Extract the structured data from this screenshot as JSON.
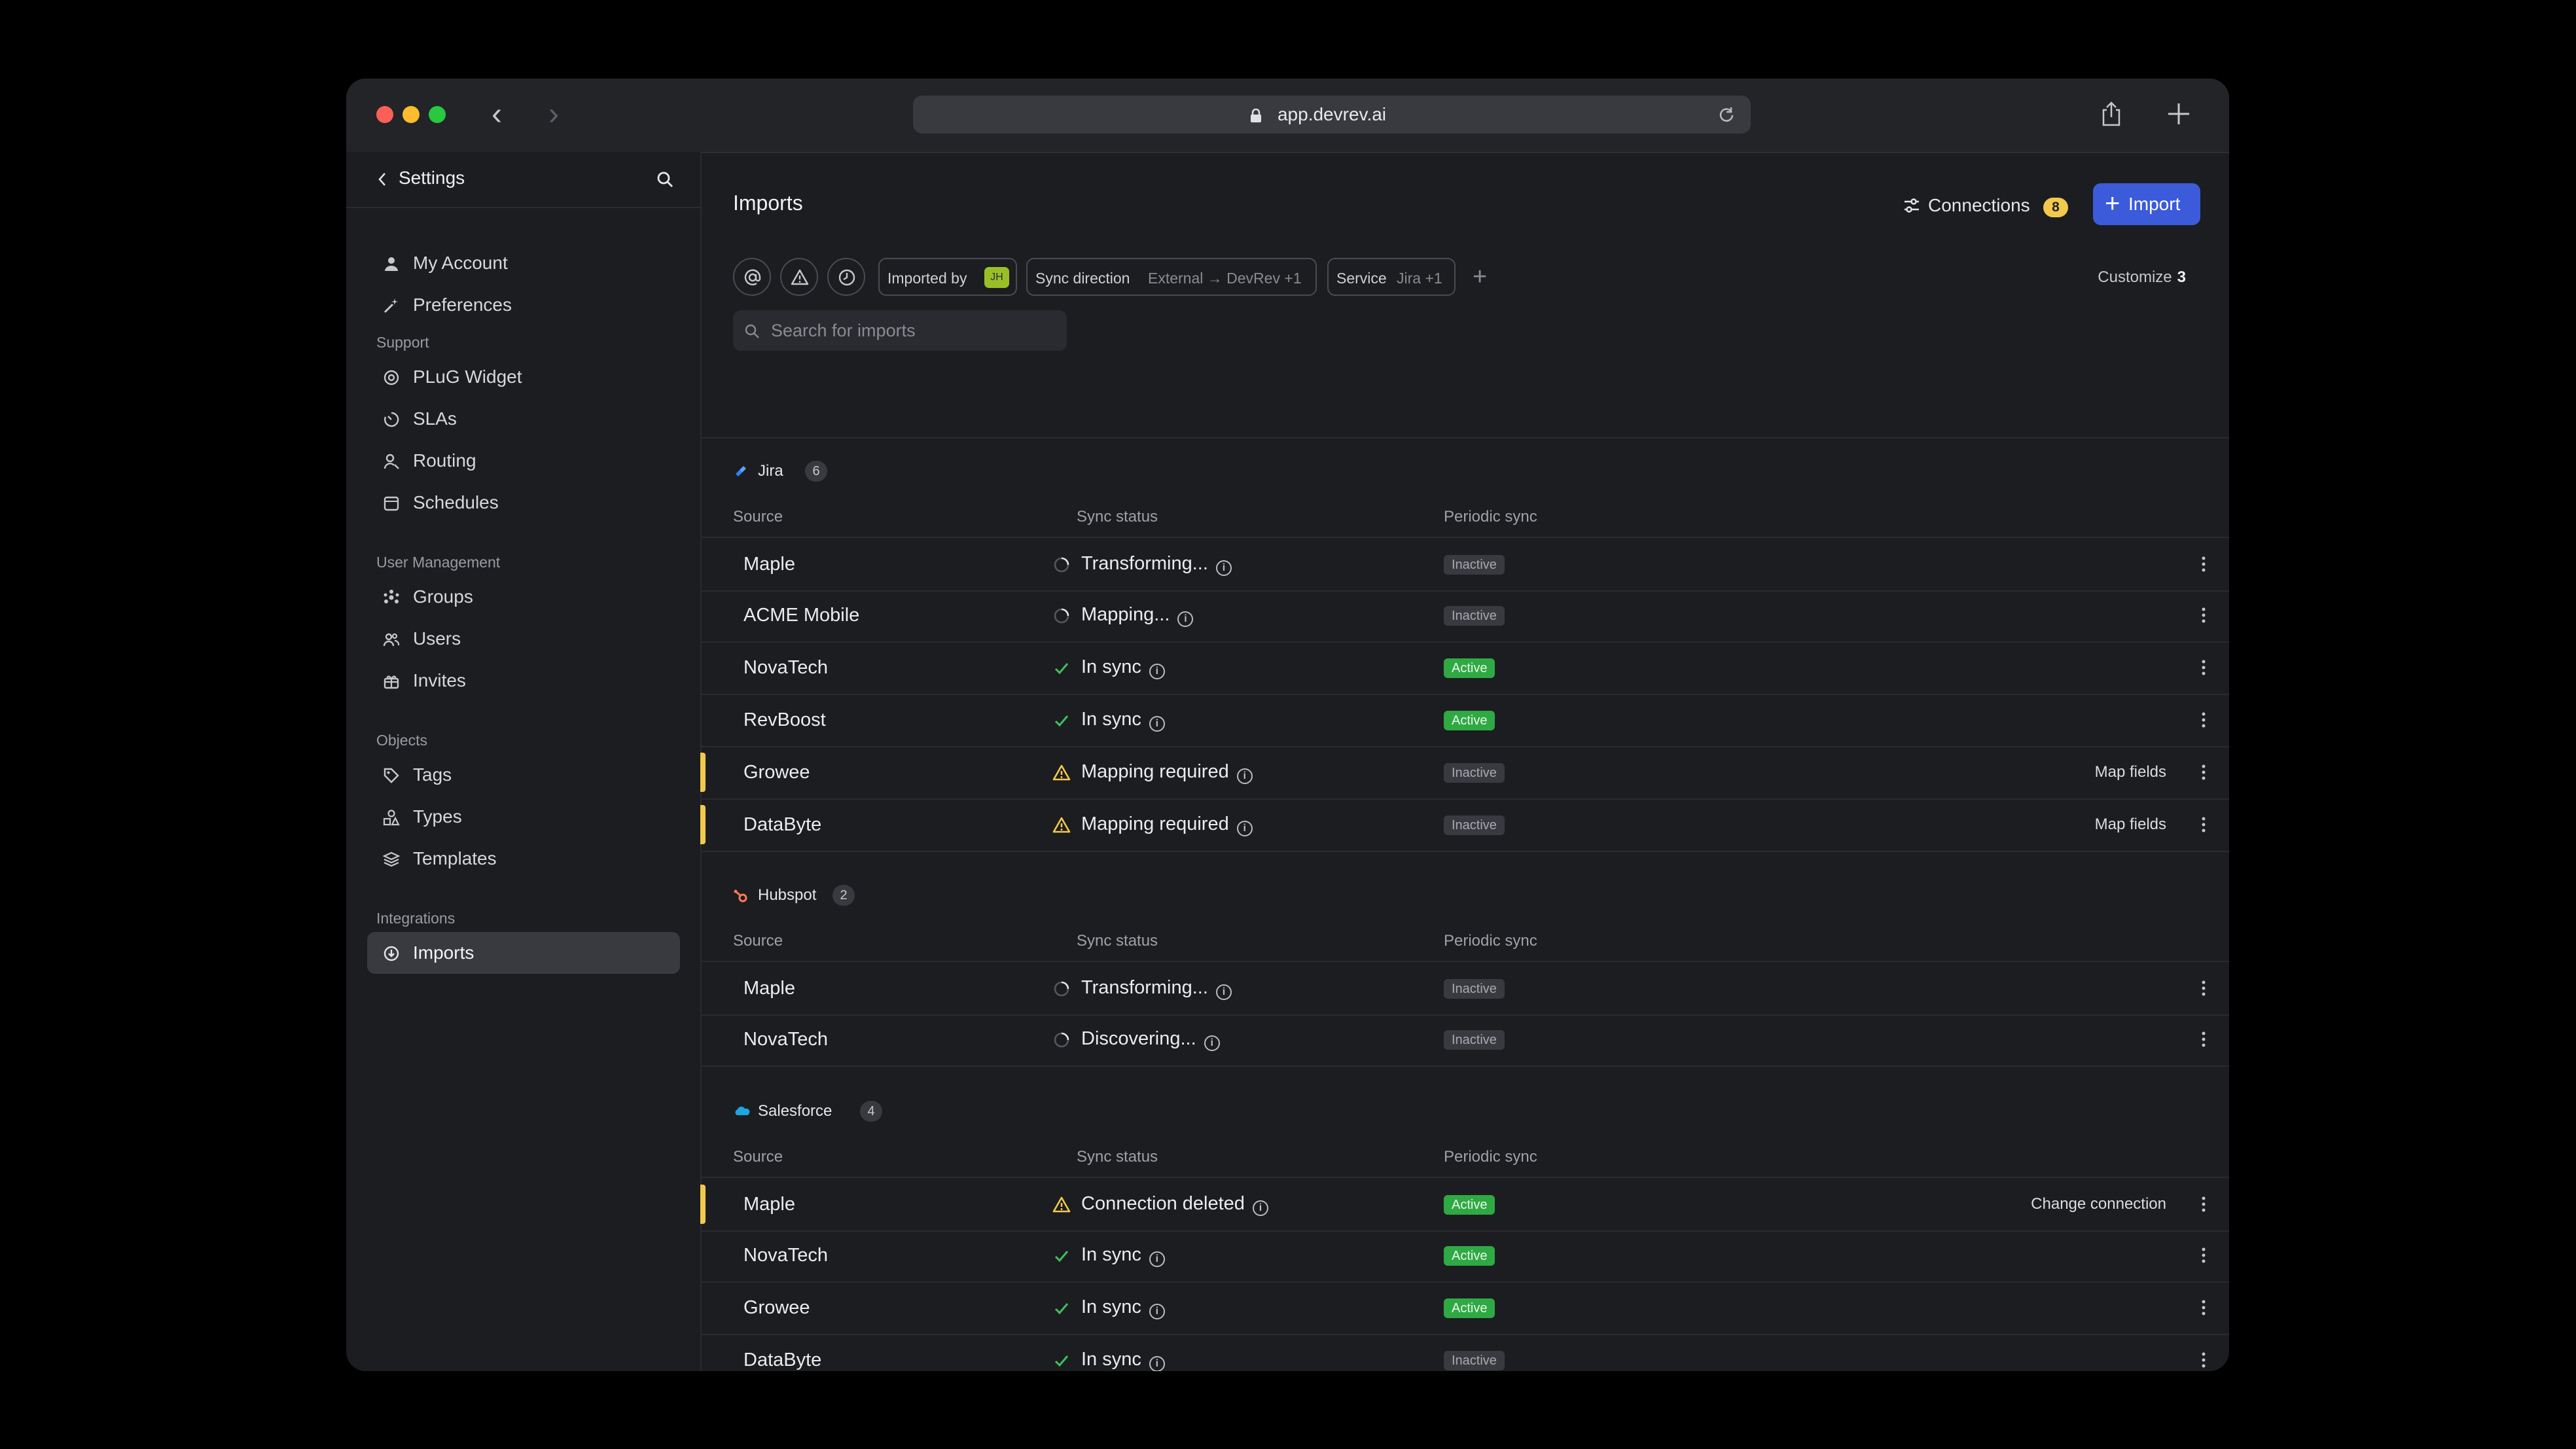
{
  "browser": {
    "url": "app.devrev.ai"
  },
  "sidebar": {
    "back_label": "Settings",
    "items_top": [
      {
        "label": "My Account",
        "icon": "user-icon"
      },
      {
        "label": "Preferences",
        "icon": "wand-icon"
      }
    ],
    "sections": [
      {
        "title": "Support",
        "items": [
          {
            "label": "PLuG Widget",
            "icon": "globe-icon"
          },
          {
            "label": "SLAs",
            "icon": "timer-icon"
          },
          {
            "label": "Routing",
            "icon": "person-route-icon"
          },
          {
            "label": "Schedules",
            "icon": "calendar-icon"
          }
        ]
      },
      {
        "title": "User Management",
        "items": [
          {
            "label": "Groups",
            "icon": "groups-icon"
          },
          {
            "label": "Users",
            "icon": "users-icon"
          },
          {
            "label": "Invites",
            "icon": "gift-icon"
          }
        ]
      },
      {
        "title": "Objects",
        "items": [
          {
            "label": "Tags",
            "icon": "tag-icon"
          },
          {
            "label": "Types",
            "icon": "shapes-icon"
          },
          {
            "label": "Templates",
            "icon": "layers-icon"
          }
        ]
      },
      {
        "title": "Integrations",
        "items": [
          {
            "label": "Imports",
            "icon": "import-icon"
          }
        ]
      }
    ]
  },
  "main": {
    "title": "Imports",
    "connections_label": "Connections",
    "connections_count": "8",
    "import_label": "Import",
    "filters": {
      "imported_by_label": "Imported by",
      "imported_by_avatar": "JH",
      "sync_direction_label": "Sync direction",
      "sync_direction_value": "External → DevRev +1",
      "service_label": "Service",
      "service_value": "Jira +1"
    },
    "customize_label": "Customize",
    "customize_count": "3",
    "search_placeholder": "Search for imports",
    "columns": {
      "source": "Source",
      "sync_status": "Sync status",
      "periodic_sync": "Periodic sync"
    },
    "groups": [
      {
        "name": "Jira",
        "count": "6",
        "icon": "jira-icon",
        "rows": [
          {
            "source": "Maple",
            "status": "Transforming...",
            "status_type": "loading",
            "periodic": "Inactive",
            "action": ""
          },
          {
            "source": "ACME Mobile",
            "status": "Mapping...",
            "status_type": "loading",
            "periodic": "Inactive",
            "action": ""
          },
          {
            "source": "NovaTech",
            "status": "In sync",
            "status_type": "ok",
            "periodic": "Active",
            "action": ""
          },
          {
            "source": "RevBoost",
            "status": "In sync",
            "status_type": "ok",
            "periodic": "Active",
            "action": ""
          },
          {
            "source": "Growee",
            "status": "Mapping required",
            "status_type": "warning",
            "periodic": "Inactive",
            "action": "Map fields"
          },
          {
            "source": "DataByte",
            "status": "Mapping required",
            "status_type": "warning",
            "periodic": "Inactive",
            "action": "Map fields"
          }
        ]
      },
      {
        "name": "Hubspot",
        "count": "2",
        "icon": "hubspot-icon",
        "rows": [
          {
            "source": "Maple",
            "status": "Transforming...",
            "status_type": "loading",
            "periodic": "Inactive",
            "action": ""
          },
          {
            "source": "NovaTech",
            "status": "Discovering...",
            "status_type": "loading",
            "periodic": "Inactive",
            "action": ""
          }
        ]
      },
      {
        "name": "Salesforce",
        "count": "4",
        "icon": "salesforce-icon",
        "rows": [
          {
            "source": "Maple",
            "status": "Connection deleted",
            "status_type": "warning",
            "periodic": "Active",
            "action": "Change connection"
          },
          {
            "source": "NovaTech",
            "status": "In sync",
            "status_type": "ok",
            "periodic": "Active",
            "action": ""
          },
          {
            "source": "Growee",
            "status": "In sync",
            "status_type": "ok",
            "periodic": "Active",
            "action": ""
          },
          {
            "source": "DataByte",
            "status": "In sync",
            "status_type": "ok",
            "periodic": "Inactive",
            "action": ""
          }
        ]
      }
    ],
    "colors": {
      "accent": "#3b5bdb",
      "active": "#2fa944",
      "warning": "#f2c94c"
    }
  }
}
